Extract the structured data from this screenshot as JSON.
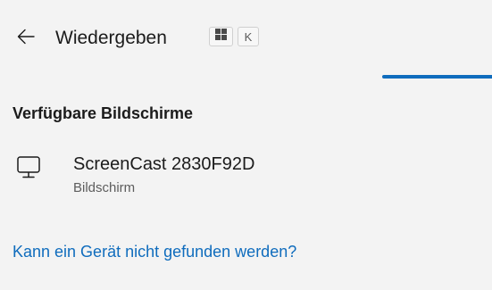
{
  "header": {
    "back_icon": "arrow-left-icon",
    "title": "Wiedergeben",
    "shortcut": {
      "modifier_icon": "windows-logo-icon",
      "key": "K"
    }
  },
  "progress": {
    "state": "indeterminate",
    "color": "#0f6cbd"
  },
  "section": {
    "heading": "Verfügbare Bildschirme"
  },
  "devices": [
    {
      "icon": "monitor-icon",
      "name": "ScreenCast 2830F92D",
      "type": "Bildschirm"
    }
  ],
  "help_link": "Kann ein Gerät nicht gefunden werden?",
  "colors": {
    "background": "#f3f3f3",
    "accent": "#0f6cbd",
    "text": "#1b1b1b",
    "secondary_text": "#5d5d5d"
  }
}
